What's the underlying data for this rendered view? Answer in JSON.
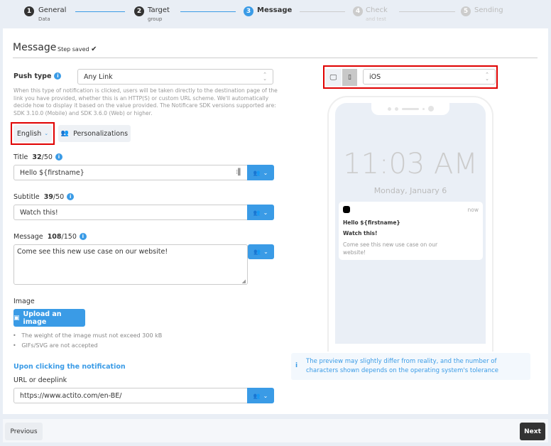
{
  "stepper": [
    {
      "num": "1",
      "label": "General",
      "sub": "Data",
      "state": "done"
    },
    {
      "num": "2",
      "label": "Target",
      "sub": "group",
      "state": "done"
    },
    {
      "num": "3",
      "label": "Message",
      "sub": "",
      "state": "active"
    },
    {
      "num": "4",
      "label": "Check",
      "sub": "and test",
      "state": "pending"
    },
    {
      "num": "5",
      "label": "Sending",
      "sub": "",
      "state": "pending"
    }
  ],
  "header": {
    "title": "Message",
    "status": "Step saved",
    "status_icon": "check-icon"
  },
  "push_type": {
    "label": "Push type",
    "value": "Any Link",
    "help": "When this type of notification is clicked, users will be taken directly to the destination page of the link you have provided, whether this is an HTTP(S) or custom URL scheme. We'll automatically decide how to display it based on the value provided. The Notificare SDK versions supported are: SDK 3.10.0 (Mobile) and SDK 3.6.0 (Web) or higher."
  },
  "language": {
    "label": "English"
  },
  "personalizations": {
    "label": "Personalizations"
  },
  "title_field": {
    "label": "Title",
    "count": "32",
    "max": "/50",
    "value": "Hello ${firstname}"
  },
  "subtitle_field": {
    "label": "Subtitle",
    "count": "39",
    "max": "/50",
    "value": "Watch this!"
  },
  "message_field": {
    "label": "Message",
    "count": "108",
    "max": "/150",
    "value": "Come see this new use case on our website!"
  },
  "image": {
    "label": "Image",
    "button": "Upload an image",
    "notes": [
      "The weight of the image must not exceed 300 kB",
      "GIFs/SVG are not accepted"
    ]
  },
  "on_click": {
    "heading": "Upon clicking the notification",
    "url_label": "URL or deeplink",
    "url_value": "https://www.actito.com/en-BE/"
  },
  "preview": {
    "os": "iOS",
    "time": "11:03 AM",
    "date": "Monday, January 6",
    "notif_time": "now",
    "notif_title": "Hello ${firstname}",
    "notif_subtitle": "Watch this!",
    "notif_body": "Come see this new use case on our website!",
    "disclaimer": "The preview may slightly differ from reality, and the number of characters shown depends on the operating system's tolerance"
  },
  "footer": {
    "previous": "Previous",
    "next": "Next"
  },
  "colors": {
    "accent": "#3a9be6",
    "dark": "#333333",
    "highlight": "#e00000"
  }
}
